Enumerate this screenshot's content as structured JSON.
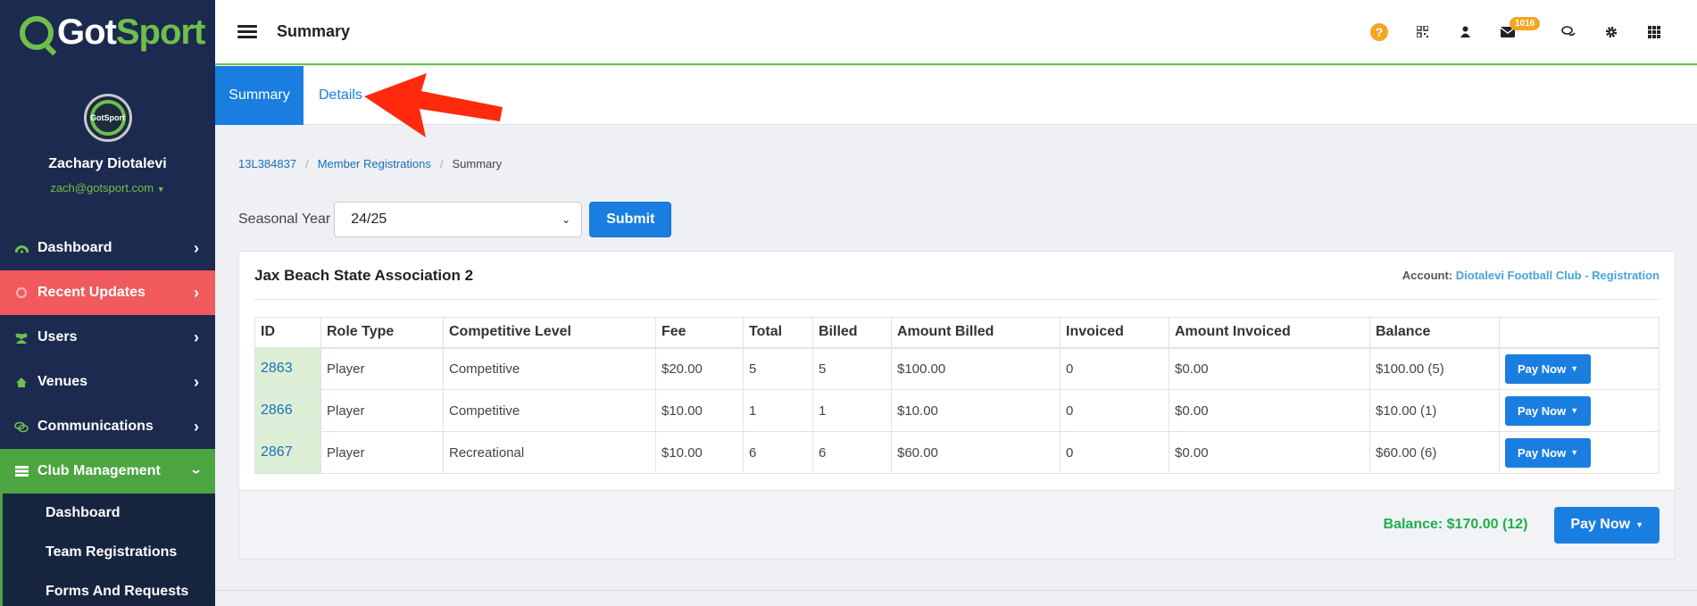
{
  "brand": {
    "logo_part1": "Got",
    "logo_part2": "Sport",
    "avatar_text": "GotSport"
  },
  "profile": {
    "name": "Zachary Diotalevi",
    "email": "zach@gotsport.com"
  },
  "sidebar": {
    "items": [
      {
        "label": "Dashboard",
        "icon": "dashboard-icon"
      },
      {
        "label": "Recent Updates",
        "icon": "refresh-icon"
      },
      {
        "label": "Users",
        "icon": "users-icon"
      },
      {
        "label": "Venues",
        "icon": "home-icon"
      },
      {
        "label": "Communications",
        "icon": "comments-icon"
      },
      {
        "label": "Club Management",
        "icon": "list-icon"
      }
    ],
    "sub_items": [
      "Dashboard",
      "Team Registrations",
      "Forms And Requests"
    ]
  },
  "header": {
    "title": "Summary",
    "mail_count": "1016",
    "help_glyph": "?"
  },
  "tabs": [
    {
      "label": "Summary"
    },
    {
      "label": "Details"
    }
  ],
  "breadcrumb": {
    "item1": "13L384837",
    "item2": "Member Registrations",
    "item3": "Summary"
  },
  "filter": {
    "label": "Seasonal Year",
    "selected": "24/25",
    "submit_label": "Submit"
  },
  "card": {
    "title": "Jax Beach State Association 2",
    "account_label": "Account:",
    "account_value": "Diotalevi Football Club - Registration",
    "columns": [
      "ID",
      "Role Type",
      "Competitive Level",
      "Fee",
      "Total",
      "Billed",
      "Amount Billed",
      "Invoiced",
      "Amount Invoiced",
      "Balance",
      ""
    ],
    "rows": [
      {
        "id": "2863",
        "role": "Player",
        "level": "Competitive",
        "fee": "$20.00",
        "total": "5",
        "billed": "5",
        "amount_billed": "$100.00",
        "invoiced": "0",
        "amount_invoiced": "$0.00",
        "balance": "$100.00 (5)",
        "action": "Pay Now"
      },
      {
        "id": "2866",
        "role": "Player",
        "level": "Competitive",
        "fee": "$10.00",
        "total": "1",
        "billed": "1",
        "amount_billed": "$10.00",
        "invoiced": "0",
        "amount_invoiced": "$0.00",
        "balance": "$10.00 (1)",
        "action": "Pay Now"
      },
      {
        "id": "2867",
        "role": "Player",
        "level": "Recreational",
        "fee": "$10.00",
        "total": "6",
        "billed": "6",
        "amount_billed": "$60.00",
        "invoiced": "0",
        "amount_invoiced": "$0.00",
        "balance": "$60.00 (6)",
        "action": "Pay Now"
      }
    ],
    "total_balance": "Balance: $170.00 (12)",
    "pay_all_label": "Pay Now"
  },
  "colors": {
    "accent": "#1a7ee0",
    "brand_green": "#6ec04a",
    "sidebar_bg": "#1b2a4e",
    "alert": "#f05a5d",
    "arrow": "#ff2a0d"
  }
}
